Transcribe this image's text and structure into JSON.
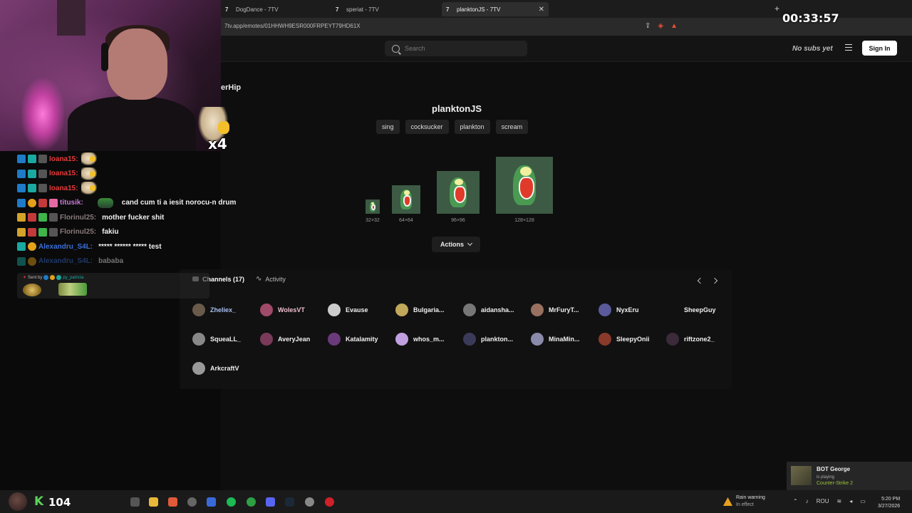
{
  "browser": {
    "tabs": [
      {
        "label": "DogDance - 7TV",
        "active": false
      },
      {
        "label": "speriat - 7TV",
        "active": false
      },
      {
        "label": "planktonJS - 7TV",
        "active": true
      }
    ],
    "url": "7tv.app/emotes/01HHWH9ESR000FRPEYT79HD61X"
  },
  "stream": {
    "timer": "00:33:57",
    "overlay_label": "erHip",
    "overlay_count": "x4"
  },
  "chat": {
    "lines": [
      {
        "user": "Ioana15:",
        "color": "#e63a3a",
        "message": ""
      },
      {
        "user": "Ioana15:",
        "color": "#e63a3a",
        "message": ""
      },
      {
        "user": "Ioana15:",
        "color": "#e63a3a",
        "message": ""
      },
      {
        "user": "titusik:",
        "color": "#c77ad8",
        "message": "cand cum ti a iesit norocu-n drum"
      },
      {
        "user": "Florinul25:",
        "color": "#8a7b7b",
        "message": "mother fucker shit"
      },
      {
        "user": "Florinul25:",
        "color": "#8a7b7b",
        "message": "fakiu"
      },
      {
        "user": "Alexandru_S4L:",
        "color": "#3a6fd8",
        "message": "***** ****** ***** test"
      },
      {
        "user": "Alexandru_S4L:",
        "color": "#3a6fd8",
        "message": "bababa"
      }
    ],
    "sent_by_label": "Sent by",
    "sent_by_user": "py_patricia"
  },
  "site": {
    "search_placeholder": "Search",
    "nosubs": "No subs yet",
    "signin": "Sign In",
    "emote_name": "planktonJS",
    "tags": [
      "sing",
      "cocksucker",
      "plankton",
      "scream"
    ],
    "sizes": [
      "32×32",
      "64×64",
      "96×96",
      "128×128"
    ],
    "actions": "Actions",
    "tabs": {
      "channels": "Channels (17)",
      "activity": "Activity"
    },
    "channels": [
      {
        "name": "Zheliex_",
        "color": "#a7c0f0"
      },
      {
        "name": "WolesVT",
        "color": "#f0c0d0"
      },
      {
        "name": "Evause",
        "color": "#f0f0f0"
      },
      {
        "name": "Bulgaria...",
        "color": "#f0f0f0"
      },
      {
        "name": "aidansha...",
        "color": "#f0f0f0"
      },
      {
        "name": "MrFuryT...",
        "color": "#f0f0f0"
      },
      {
        "name": "NyxEru",
        "color": "#f0f0f0"
      },
      {
        "name": "SheepGuy",
        "color": "#f0f0f0"
      },
      {
        "name": "SqueaLL_",
        "color": "#f0f0f0"
      },
      {
        "name": "AveryJean",
        "color": "#f0f0f0"
      },
      {
        "name": "Katalamity",
        "color": "#f0f0f0"
      },
      {
        "name": "whos_m...",
        "color": "#f0f0f0"
      },
      {
        "name": "plankton...",
        "color": "#f0f0f0"
      },
      {
        "name": "MinaMin...",
        "color": "#f0f0f0"
      },
      {
        "name": "SleepyOnii",
        "color": "#f0f0f0"
      },
      {
        "name": "riftzone2_",
        "color": "#f0f0f0"
      },
      {
        "name": "ArkcraftV",
        "color": "#f0f0f0"
      }
    ]
  },
  "taskbar": {
    "k_letter": "K",
    "k_count": "104",
    "weather_title": "Rain warning",
    "weather_sub": "In effect",
    "lang": "ROU",
    "time": "5:20 PM",
    "date": "3/27/2026"
  },
  "notification": {
    "name": "BOT George",
    "status": "is playing",
    "game": "Counter-Strike 2"
  }
}
